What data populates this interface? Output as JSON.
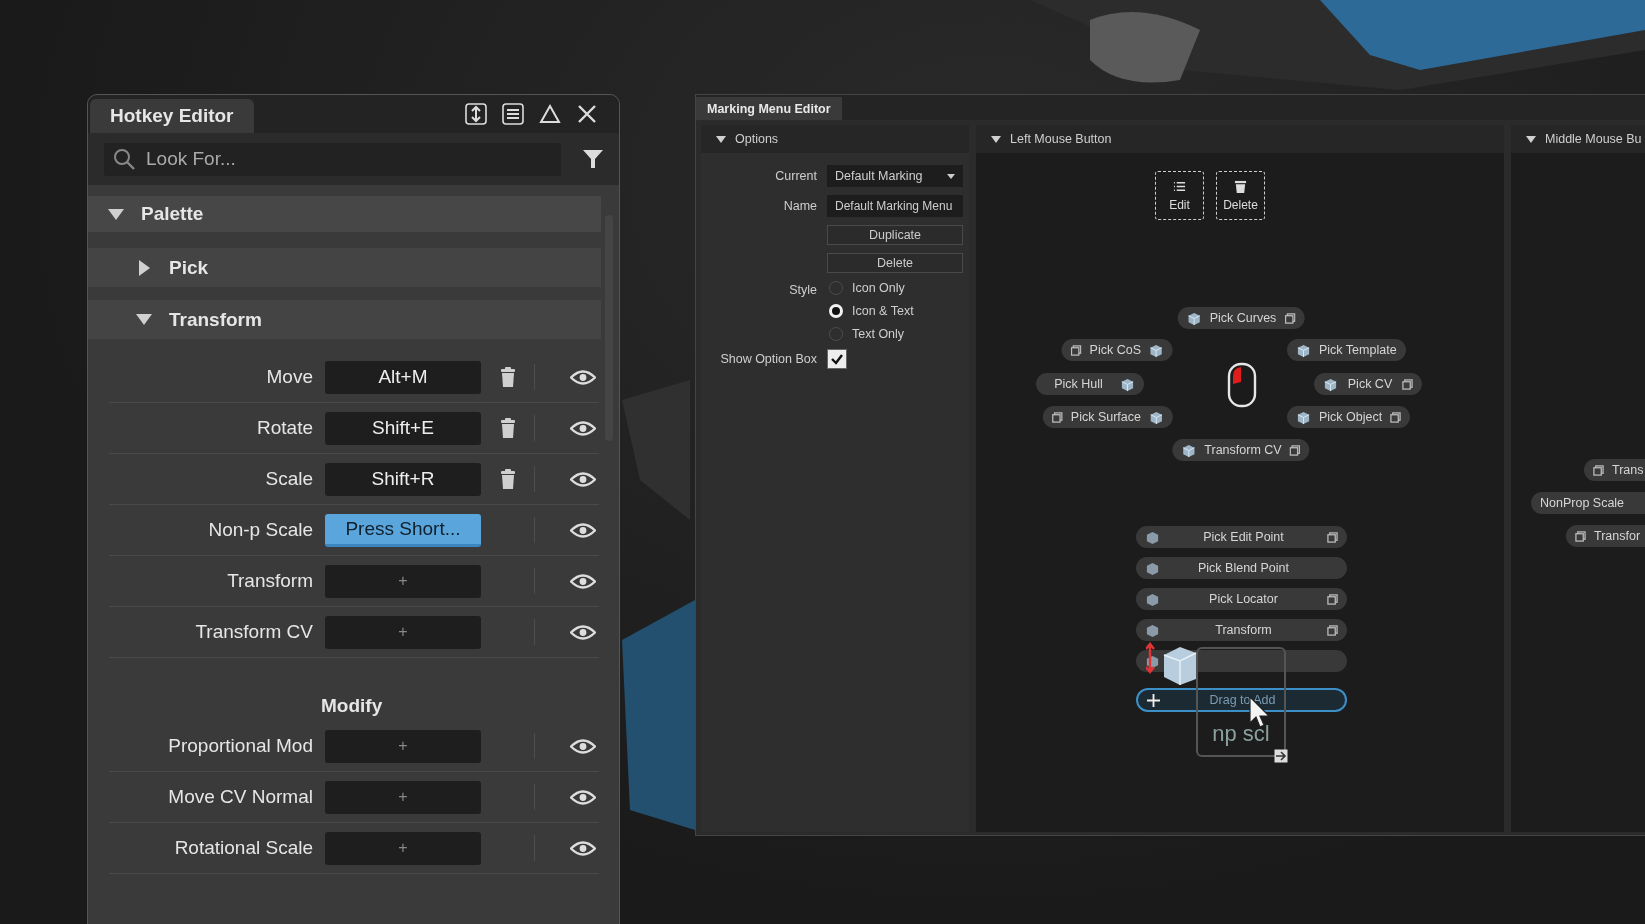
{
  "hotkey_editor": {
    "title": "Hotkey Editor",
    "search": {
      "placeholder": "Look For..."
    },
    "palette": {
      "label": "Palette",
      "expanded": true,
      "children": [
        {
          "label": "Pick",
          "expanded": false
        },
        {
          "label": "Transform",
          "expanded": true,
          "commands": [
            {
              "name": "Move",
              "kind": "assigned",
              "shortcut": "Alt+M"
            },
            {
              "name": "Rotate",
              "kind": "assigned",
              "shortcut": "Shift+E"
            },
            {
              "name": "Scale",
              "kind": "assigned",
              "shortcut": "Shift+R"
            },
            {
              "name": "Non-p Scale",
              "kind": "recording",
              "shortcut": "Press Short..."
            },
            {
              "name": "Transform",
              "kind": "empty",
              "shortcut": "+"
            },
            {
              "name": "Transform CV",
              "kind": "empty",
              "shortcut": "+"
            }
          ],
          "sections": [
            {
              "heading": "Modify",
              "commands": [
                {
                  "name": "Proportional Mod",
                  "kind": "empty",
                  "shortcut": "+"
                },
                {
                  "name": "Move CV Normal",
                  "kind": "empty",
                  "shortcut": "+"
                },
                {
                  "name": "Rotational Scale",
                  "kind": "empty",
                  "shortcut": "+"
                }
              ]
            }
          ]
        }
      ]
    }
  },
  "marking_menu_editor": {
    "title": "Marking Menu Editor",
    "options": {
      "header": "Options",
      "expanded": true,
      "current": {
        "label": "Current",
        "value": "Default Marking"
      },
      "name": {
        "label": "Name",
        "value": "Default Marking Menu"
      },
      "buttons": [
        "Duplicate",
        "Delete"
      ],
      "style": {
        "label": "Style",
        "choices": [
          {
            "label": "Icon Only",
            "selected": false
          },
          {
            "label": "Icon & Text",
            "selected": true
          },
          {
            "label": "Text Only",
            "selected": false
          }
        ]
      },
      "show_option_box": {
        "label": "Show Option Box",
        "checked": true
      }
    },
    "left_button": {
      "header": "Left Mouse Button",
      "expanded": true,
      "tools": [
        {
          "kind": "edit",
          "label": "Edit"
        },
        {
          "kind": "delete",
          "label": "Delete"
        }
      ],
      "radial": [
        {
          "label": "Pick Curves",
          "option_box": true
        },
        {
          "label": "Pick CoS",
          "option_box": true
        },
        {
          "label": "Pick Hull",
          "option_box": false
        },
        {
          "label": "Pick Surface",
          "option_box": true
        },
        {
          "label": "Transform CV",
          "option_box": true
        },
        {
          "label": "Pick Template",
          "option_box": false
        },
        {
          "label": "Pick CV",
          "option_box": true
        },
        {
          "label": "Pick Object",
          "option_box": true
        }
      ],
      "overflow": [
        {
          "label": "Pick Edit Point",
          "option_box": true
        },
        {
          "label": "Pick Blend Point",
          "option_box": false
        },
        {
          "label": "Pick Locator",
          "option_box": true
        },
        {
          "label": "Transform",
          "option_box": true
        },
        {
          "option_box": false
        }
      ],
      "drop_slot": {
        "label": "Drag to Add"
      },
      "drag_preview": {
        "label": "np scl"
      }
    },
    "middle_button": {
      "header": "Middle Mouse Bu",
      "expanded": true,
      "items": [
        {
          "label": "Trans",
          "option_box": true
        },
        {
          "label": "NonProp Scale",
          "option_box": false
        },
        {
          "label": "Transfor",
          "option_box": true
        }
      ]
    }
  }
}
